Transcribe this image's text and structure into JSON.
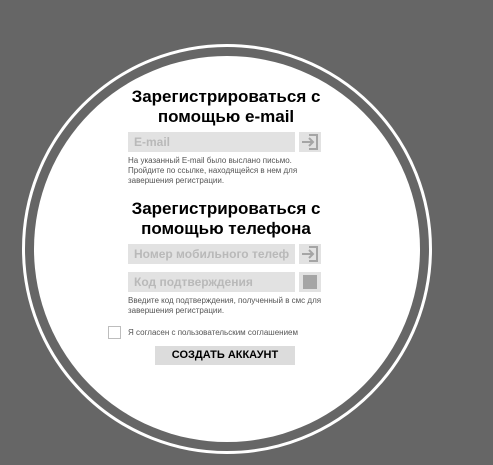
{
  "email_section": {
    "title": "Зарегистрироваться с помощью e-mail",
    "email_placeholder": "E-mail",
    "submit_icon": "arrow-into-box-icon",
    "hint": "На указанный E-mail было выслано письмо. Пройдите по ссылке, находящейся в нем для завершения регистрации."
  },
  "phone_section": {
    "title": "Зарегистрироваться с помощью телефона",
    "phone_placeholder": "Номер мобильного телефона",
    "phone_submit_icon": "arrow-into-box-icon",
    "code_placeholder": "Код подтверждения",
    "code_submit_icon": "square-icon",
    "hint": "Введите код подтверждения, полученный в смс для завершения регистрации."
  },
  "agreement": {
    "label": "Я согласен с пользовательским соглашением",
    "checked": false
  },
  "create_account_label": "СОЗДАТЬ АККАУНТ",
  "colors": {
    "background": "#666666",
    "panel": "#ffffff",
    "field": "#e2e2e2",
    "icon": "#a5a5a5"
  }
}
